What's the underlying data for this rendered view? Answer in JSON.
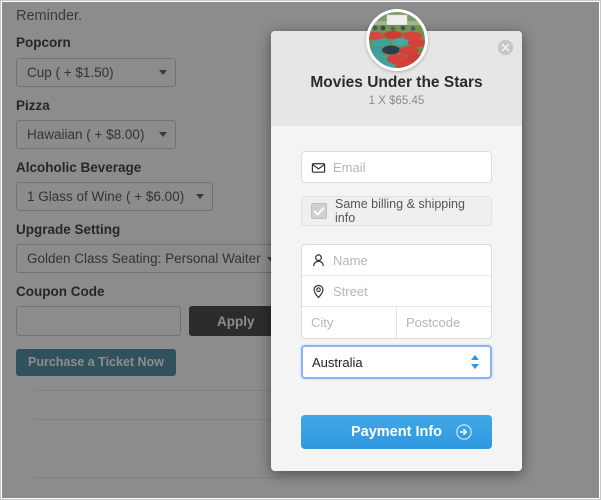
{
  "background_page": {
    "reminder_text": "Reminder.",
    "fields": [
      {
        "label": "Popcorn",
        "value": "Cup ( + $1.50)",
        "icon": "chevron-down-icon"
      },
      {
        "label": "Pizza",
        "value": "Hawaiian ( + $8.00)",
        "icon": "chevron-down-icon"
      },
      {
        "label": "Alcoholic Beverage",
        "value": "1 Glass of Wine ( + $6.00)",
        "icon": "chevron-down-icon"
      },
      {
        "label": "Upgrade Setting",
        "value": "Golden Class Seating: Personal Waiter",
        "icon": "chevron-down-icon"
      }
    ],
    "coupon": {
      "label": "Coupon Code",
      "input_value": "",
      "placeholder": "",
      "apply_label": "Apply"
    },
    "purchase_label": "Purchase a Ticket Now"
  },
  "modal": {
    "close_icon": "close-circle-icon",
    "avatar_icon": "outdoor-cinema-photo",
    "title": "Movies Under the Stars",
    "subtitle": "1 X $65.45",
    "email": {
      "icon": "envelope-icon",
      "value": "",
      "placeholder": "Email"
    },
    "same_info": {
      "icon": "checkbox-checked-icon",
      "label": "Same billing & shipping info",
      "checked": true
    },
    "address": {
      "name": {
        "icon": "person-icon",
        "value": "",
        "placeholder": "Name"
      },
      "street": {
        "icon": "map-pin-icon",
        "value": "",
        "placeholder": "Street"
      },
      "city": {
        "value": "",
        "placeholder": "City"
      },
      "postcode": {
        "value": "",
        "placeholder": "Postcode"
      }
    },
    "country": {
      "selected": "Australia",
      "icon": "stepper-updown-icon"
    },
    "submit": {
      "label": "Payment Info",
      "icon": "arrow-right-circle-icon"
    }
  },
  "colors": {
    "overlay": "#6a6a6a",
    "modal_header": "#e6e6e6",
    "modal_body": "#f4f4f5",
    "accent_blue": "#2f97dd",
    "focus_blue": "#8cb4f0",
    "apply_black": "#111111",
    "purchase_teal": "#1a6f8c"
  }
}
